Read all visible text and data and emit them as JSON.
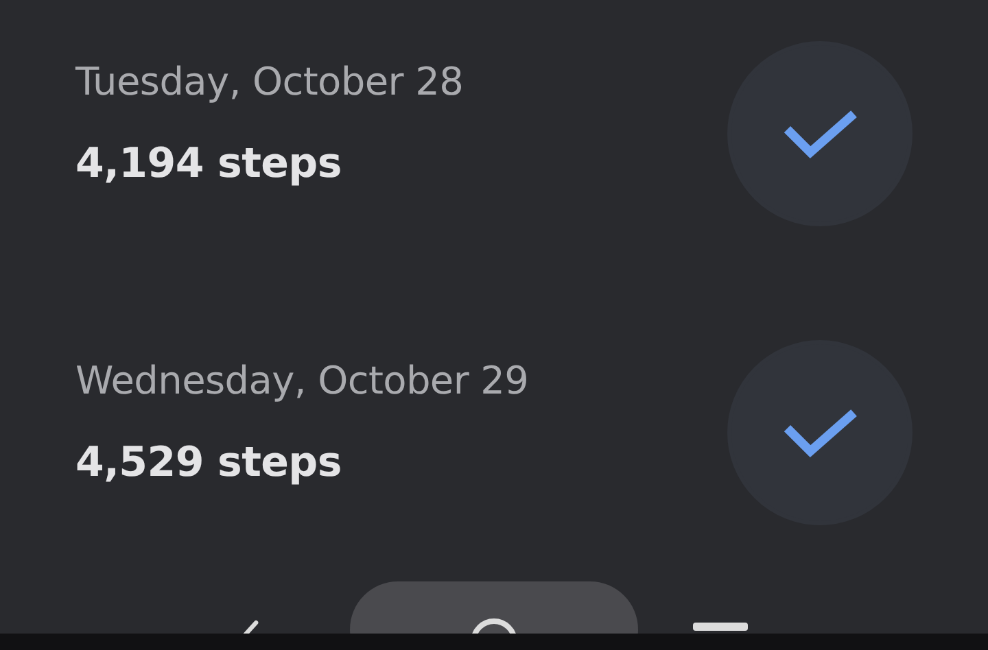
{
  "days": [
    {
      "date": "Tuesday, October 28",
      "steps": "4,194 steps",
      "checked": true
    },
    {
      "date": "Wednesday, October 29",
      "steps": "4,529 steps",
      "checked": true
    }
  ]
}
